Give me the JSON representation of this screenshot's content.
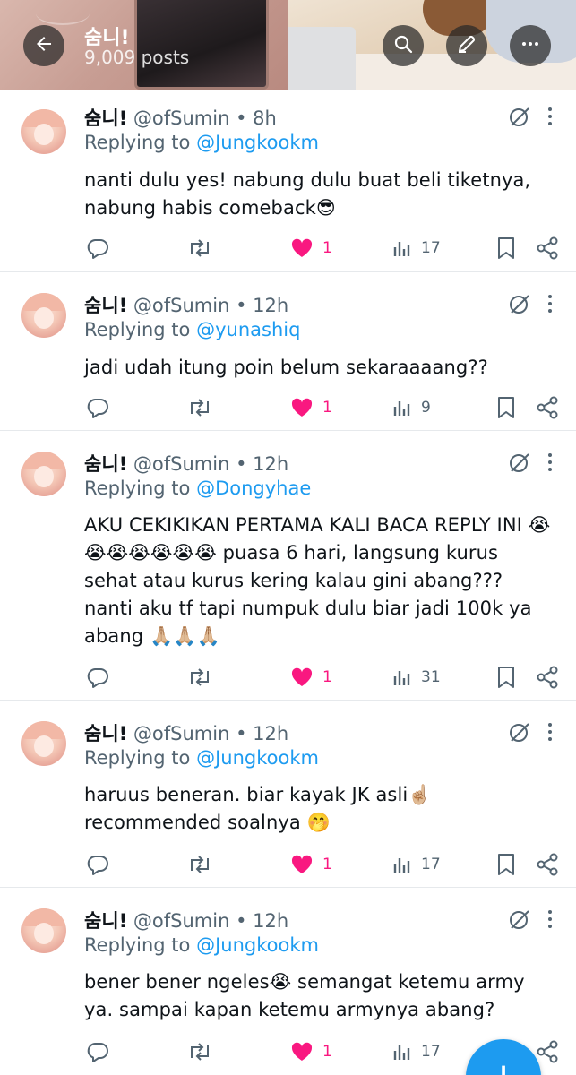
{
  "header": {
    "profile_name": "숨니!",
    "post_count": "9,009 posts",
    "icons": [
      "back-arrow-icon",
      "search-icon",
      "edit-icon",
      "more-icon"
    ]
  },
  "colors": {
    "accent": "#1d9bf0",
    "like": "#f91880",
    "secondary_text": "#536471"
  },
  "tweets": [
    {
      "name": "숨니!",
      "handle": "@ofSumin",
      "time": "8h",
      "replying_label": "Replying to",
      "replying_to": "@Jungkookm",
      "text": "nanti dulu yes! nabung dulu buat beli tiketnya, nabung habis comeback😎",
      "likes": "1",
      "views": "17"
    },
    {
      "name": "숨니!",
      "handle": "@ofSumin",
      "time": "12h",
      "replying_label": "Replying to",
      "replying_to": "@yunashiq",
      "text": "jadi udah itung poin belum sekaraaaang??",
      "likes": "1",
      "views": "9"
    },
    {
      "name": "숨니!",
      "handle": "@ofSumin",
      "time": "12h",
      "replying_label": "Replying to",
      "replying_to": "@Dongyhae",
      "text": "AKU CEKIKIKAN PERTAMA KALI BACA REPLY INI 😭😭😭😭😭😭😭 puasa 6 hari, langsung kurus sehat atau kurus kering kalau gini abang??? nanti aku tf tapi numpuk dulu biar jadi 100k ya abang 🙏🏼🙏🏼🙏🏼",
      "likes": "1",
      "views": "31"
    },
    {
      "name": "숨니!",
      "handle": "@ofSumin",
      "time": "12h",
      "replying_label": "Replying to",
      "replying_to": "@Jungkookm",
      "text": "haruus beneran. biar kayak JK asli☝🏼 recommended soalnya 🤭",
      "likes": "1",
      "views": "17"
    },
    {
      "name": "숨니!",
      "handle": "@ofSumin",
      "time": "12h",
      "replying_label": "Replying to",
      "replying_to": "@Jungkookm",
      "text": "bener bener ngeles😭  semangat ketemu army ya. sampai kapan ketemu armynya abang?",
      "likes": "1",
      "views": "17"
    }
  ],
  "fab": {
    "label": "+"
  }
}
